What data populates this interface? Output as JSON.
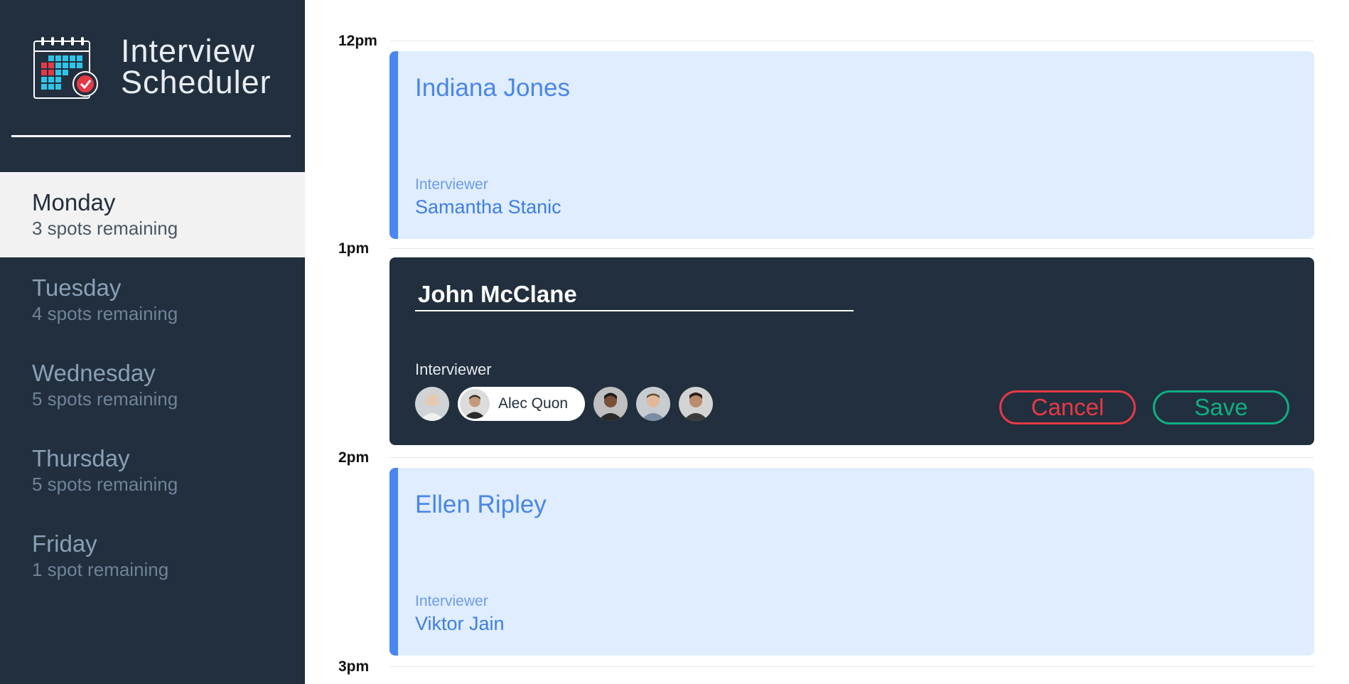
{
  "app": {
    "title_line1": "Interview",
    "title_line2": "Scheduler"
  },
  "days": [
    {
      "name": "Monday",
      "spots": "3 spots remaining",
      "selected": true
    },
    {
      "name": "Tuesday",
      "spots": "4 spots remaining",
      "selected": false
    },
    {
      "name": "Wednesday",
      "spots": "5 spots remaining",
      "selected": false
    },
    {
      "name": "Thursday",
      "spots": "5 spots remaining",
      "selected": false
    },
    {
      "name": "Friday",
      "spots": "1 spot remaining",
      "selected": false
    }
  ],
  "times": [
    "12pm",
    "1pm",
    "2pm",
    "3pm"
  ],
  "appointments": [
    {
      "student": "Indiana Jones",
      "interviewer_label": "Interviewer",
      "interviewer": "Samantha Stanic"
    },
    {
      "mode": "edit",
      "student_value": "John McClane",
      "interviewer_label": "Interviewer",
      "selected_interviewer": "Alec Quon",
      "cancel_label": "Cancel",
      "save_label": "Save"
    },
    {
      "student": "Ellen Ripley",
      "interviewer_label": "Interviewer",
      "interviewer": "Viktor Jain"
    }
  ],
  "colors": {
    "sidebar_bg": "#222f3e",
    "show_card_bg": "#dfedff",
    "accent_blue": "#4a86f0",
    "cancel_red": "#e63946",
    "save_green": "#0fae82"
  }
}
